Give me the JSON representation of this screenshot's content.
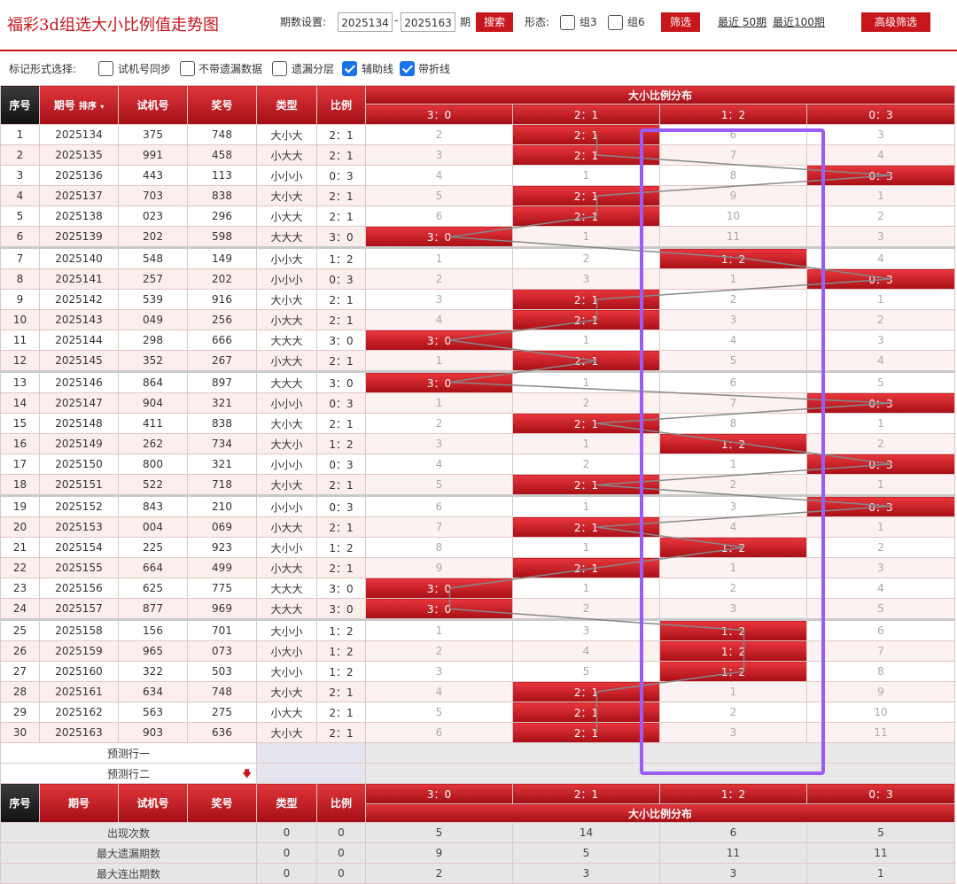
{
  "title": "福彩3d组选大小比例值走势图",
  "toolbar": {
    "period_label": "期数设置:",
    "from": "2025134",
    "dash": "-",
    "to": "2025163",
    "period_unit": "期",
    "search": "搜索",
    "form_label": "形态:",
    "opt_group3": "组3",
    "opt_group6": "组6",
    "filter": "筛选",
    "recent50": "最近 50期",
    "recent100": "最近100期",
    "advanced": "高级筛选"
  },
  "mark": {
    "label": "标记形式选择:",
    "opts": [
      {
        "text": "试机号同步",
        "checked": false
      },
      {
        "text": "不带遗漏数据",
        "checked": false
      },
      {
        "text": "遗漏分层",
        "checked": false
      },
      {
        "text": "辅助线",
        "checked": true
      },
      {
        "text": "带折线",
        "checked": true
      }
    ]
  },
  "headers": {
    "seq": "序号",
    "period": "期号",
    "sort": "排序",
    "trial": "试机号",
    "award": "奖号",
    "type": "类型",
    "ratio": "比例",
    "dist": "大小比例分布",
    "cols": [
      "3：0",
      "2：1",
      "1：2",
      "0：3"
    ]
  },
  "colors": {
    "accent": "#c8161d",
    "frame": "#9b5cf6"
  },
  "rows": [
    {
      "n": "1",
      "p": "2025134",
      "t": "375",
      "a": "748",
      "ty": "大小大",
      "r": "2：1",
      "h": 1,
      "v": [
        "2",
        "",
        "6",
        "3"
      ]
    },
    {
      "n": "2",
      "p": "2025135",
      "t": "991",
      "a": "458",
      "ty": "小大大",
      "r": "2：1",
      "h": 1,
      "v": [
        "3",
        "",
        "7",
        "4"
      ]
    },
    {
      "n": "3",
      "p": "2025136",
      "t": "443",
      "a": "113",
      "ty": "小小小",
      "r": "0：3",
      "h": 3,
      "v": [
        "4",
        "1",
        "8",
        ""
      ]
    },
    {
      "n": "4",
      "p": "2025137",
      "t": "703",
      "a": "838",
      "ty": "大小大",
      "r": "2：1",
      "h": 1,
      "v": [
        "5",
        "",
        "9",
        "1"
      ]
    },
    {
      "n": "5",
      "p": "2025138",
      "t": "023",
      "a": "296",
      "ty": "小大大",
      "r": "2：1",
      "h": 1,
      "v": [
        "6",
        "",
        "10",
        "2"
      ]
    },
    {
      "n": "6",
      "p": "2025139",
      "t": "202",
      "a": "598",
      "ty": "大大大",
      "r": "3：0",
      "h": 0,
      "v": [
        "",
        "1",
        "11",
        "3"
      ]
    },
    {
      "n": "7",
      "p": "2025140",
      "t": "548",
      "a": "149",
      "ty": "小小大",
      "r": "1：2",
      "h": 2,
      "v": [
        "1",
        "2",
        "",
        "4"
      ]
    },
    {
      "n": "8",
      "p": "2025141",
      "t": "257",
      "a": "202",
      "ty": "小小小",
      "r": "0：3",
      "h": 3,
      "v": [
        "2",
        "3",
        "1",
        ""
      ]
    },
    {
      "n": "9",
      "p": "2025142",
      "t": "539",
      "a": "916",
      "ty": "大小大",
      "r": "2：1",
      "h": 1,
      "v": [
        "3",
        "",
        "2",
        "1"
      ]
    },
    {
      "n": "10",
      "p": "2025143",
      "t": "049",
      "a": "256",
      "ty": "小大大",
      "r": "2：1",
      "h": 1,
      "v": [
        "4",
        "",
        "3",
        "2"
      ]
    },
    {
      "n": "11",
      "p": "2025144",
      "t": "298",
      "a": "666",
      "ty": "大大大",
      "r": "3：0",
      "h": 0,
      "v": [
        "",
        "1",
        "4",
        "3"
      ]
    },
    {
      "n": "12",
      "p": "2025145",
      "t": "352",
      "a": "267",
      "ty": "小大大",
      "r": "2：1",
      "h": 1,
      "v": [
        "1",
        "",
        "5",
        "4"
      ]
    },
    {
      "n": "13",
      "p": "2025146",
      "t": "864",
      "a": "897",
      "ty": "大大大",
      "r": "3：0",
      "h": 0,
      "v": [
        "",
        "1",
        "6",
        "5"
      ]
    },
    {
      "n": "14",
      "p": "2025147",
      "t": "904",
      "a": "321",
      "ty": "小小小",
      "r": "0：3",
      "h": 3,
      "v": [
        "1",
        "2",
        "7",
        ""
      ]
    },
    {
      "n": "15",
      "p": "2025148",
      "t": "411",
      "a": "838",
      "ty": "大小大",
      "r": "2：1",
      "h": 1,
      "v": [
        "2",
        "",
        "8",
        "1"
      ]
    },
    {
      "n": "16",
      "p": "2025149",
      "t": "262",
      "a": "734",
      "ty": "大大小",
      "r": "1：2",
      "h": 2,
      "v": [
        "3",
        "1",
        "",
        "2"
      ]
    },
    {
      "n": "17",
      "p": "2025150",
      "t": "800",
      "a": "321",
      "ty": "小小小",
      "r": "0：3",
      "h": 3,
      "v": [
        "4",
        "2",
        "1",
        ""
      ]
    },
    {
      "n": "18",
      "p": "2025151",
      "t": "522",
      "a": "718",
      "ty": "大小大",
      "r": "2：1",
      "h": 1,
      "v": [
        "5",
        "",
        "2",
        "1"
      ]
    },
    {
      "n": "19",
      "p": "2025152",
      "t": "843",
      "a": "210",
      "ty": "小小小",
      "r": "0：3",
      "h": 3,
      "v": [
        "6",
        "1",
        "3",
        ""
      ]
    },
    {
      "n": "20",
      "p": "2025153",
      "t": "004",
      "a": "069",
      "ty": "小大大",
      "r": "2：1",
      "h": 1,
      "v": [
        "7",
        "",
        "4",
        "1"
      ]
    },
    {
      "n": "21",
      "p": "2025154",
      "t": "225",
      "a": "923",
      "ty": "大小小",
      "r": "1：2",
      "h": 2,
      "v": [
        "8",
        "1",
        "",
        "2"
      ]
    },
    {
      "n": "22",
      "p": "2025155",
      "t": "664",
      "a": "499",
      "ty": "小大大",
      "r": "2：1",
      "h": 1,
      "v": [
        "9",
        "",
        "1",
        "3"
      ]
    },
    {
      "n": "23",
      "p": "2025156",
      "t": "625",
      "a": "775",
      "ty": "大大大",
      "r": "3：0",
      "h": 0,
      "v": [
        "",
        "1",
        "2",
        "4"
      ]
    },
    {
      "n": "24",
      "p": "2025157",
      "t": "877",
      "a": "969",
      "ty": "大大大",
      "r": "3：0",
      "h": 0,
      "v": [
        "",
        "2",
        "3",
        "5"
      ]
    },
    {
      "n": "25",
      "p": "2025158",
      "t": "156",
      "a": "701",
      "ty": "大小小",
      "r": "1：2",
      "h": 2,
      "v": [
        "1",
        "3",
        "",
        "6"
      ]
    },
    {
      "n": "26",
      "p": "2025159",
      "t": "965",
      "a": "073",
      "ty": "小大小",
      "r": "1：2",
      "h": 2,
      "v": [
        "2",
        "4",
        "",
        "7"
      ]
    },
    {
      "n": "27",
      "p": "2025160",
      "t": "322",
      "a": "503",
      "ty": "大小小",
      "r": "1：2",
      "h": 2,
      "v": [
        "3",
        "5",
        "",
        "8"
      ]
    },
    {
      "n": "28",
      "p": "2025161",
      "t": "634",
      "a": "748",
      "ty": "大小大",
      "r": "2：1",
      "h": 1,
      "v": [
        "4",
        "",
        "1",
        "9"
      ]
    },
    {
      "n": "29",
      "p": "2025162",
      "t": "563",
      "a": "275",
      "ty": "小大大",
      "r": "2：1",
      "h": 1,
      "v": [
        "5",
        "",
        "2",
        "10"
      ]
    },
    {
      "n": "30",
      "p": "2025163",
      "t": "903",
      "a": "636",
      "ty": "大小大",
      "r": "2：1",
      "h": 1,
      "v": [
        "6",
        "",
        "3",
        "11"
      ]
    }
  ],
  "predict": [
    "预测行一",
    "预测行二"
  ],
  "stats": [
    {
      "label": "出现次数",
      "a": "0",
      "b": "0",
      "v": [
        "5",
        "14",
        "6",
        "5"
      ]
    },
    {
      "label": "最大遗漏期数",
      "a": "0",
      "b": "0",
      "v": [
        "9",
        "5",
        "11",
        "11"
      ]
    },
    {
      "label": "最大连出期数",
      "a": "0",
      "b": "0",
      "v": [
        "2",
        "3",
        "3",
        "1"
      ]
    }
  ]
}
